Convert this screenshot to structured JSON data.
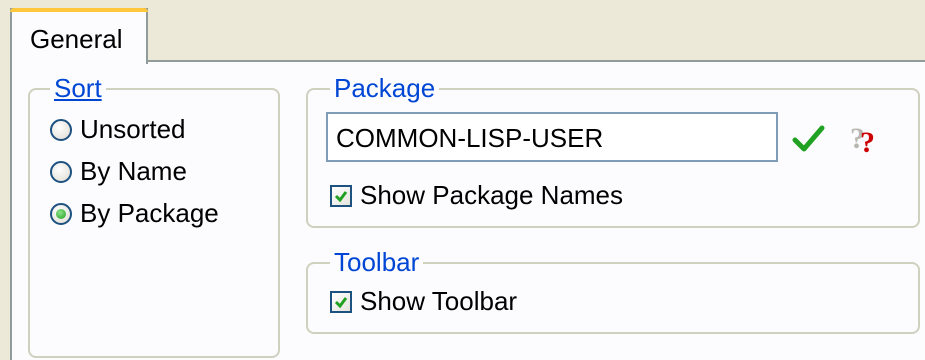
{
  "tabs": [
    {
      "label": "General",
      "selected": true
    }
  ],
  "sort_group": {
    "legend": "Sort",
    "options": [
      {
        "label": "Unsorted",
        "checked": false
      },
      {
        "label": "By Name",
        "checked": false
      },
      {
        "label": "By Package",
        "checked": true
      }
    ]
  },
  "package_group": {
    "legend": "Package",
    "input_value": "COMMON-LISP-USER",
    "show_package_names_label": "Show Package Names",
    "show_package_names_checked": true,
    "icons": {
      "apply": "checkmark-icon",
      "help": "question-help-icon"
    }
  },
  "toolbar_group": {
    "legend": "Toolbar",
    "show_toolbar_label": "Show Toolbar",
    "show_toolbar_checked": true
  },
  "colors": {
    "legend_text": "#0046d5",
    "tab_accent": "#ffc83c",
    "check_green": "#21a121",
    "help_red": "#cc0000"
  }
}
